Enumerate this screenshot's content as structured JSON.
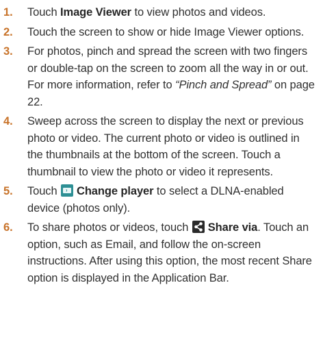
{
  "steps": [
    {
      "num": "1.",
      "parts": [
        {
          "t": "text",
          "v": "Touch "
        },
        {
          "t": "bold",
          "v": "Image Viewer"
        },
        {
          "t": "text",
          "v": " to view photos and videos."
        }
      ]
    },
    {
      "num": "2.",
      "parts": [
        {
          "t": "text",
          "v": "Touch the screen to show or hide Image Viewer options."
        }
      ]
    },
    {
      "num": "3.",
      "parts": [
        {
          "t": "text",
          "v": "For photos, pinch and spread the screen with two fingers or double-tap on the screen to zoom all the way in or out. For more information, refer to "
        },
        {
          "t": "italic",
          "v": "“Pinch and Spread”"
        },
        {
          "t": "text",
          "v": " on page 22."
        }
      ]
    },
    {
      "num": "4.",
      "parts": [
        {
          "t": "text",
          "v": "Sweep across the screen to display the next or previous photo or video. The current photo or video is outlined in the thumbnails at the bottom of the screen. Touch a thumbnail to view the photo or video it represents."
        }
      ]
    },
    {
      "num": "5.",
      "parts": [
        {
          "t": "text",
          "v": "Touch "
        },
        {
          "t": "icon",
          "v": "change-player-icon"
        },
        {
          "t": "bold",
          "v": "Change player"
        },
        {
          "t": "text",
          "v": " to select a DLNA-enabled device (photos only)."
        }
      ]
    },
    {
      "num": "6.",
      "parts": [
        {
          "t": "text",
          "v": "To share photos or videos, touch "
        },
        {
          "t": "icon",
          "v": "share-icon"
        },
        {
          "t": "bold",
          "v": "Share via"
        },
        {
          "t": "text",
          "v": ". Touch an option, such as Email, and follow the on-screen instructions. After using this option, the most recent Share option is displayed in the Application Bar."
        }
      ]
    }
  ],
  "colors": {
    "step_number": "#c8732a",
    "body_text": "#303030",
    "change_player_icon_bg": "#2d8f94",
    "share_icon_bg": "#2a2a2a"
  }
}
